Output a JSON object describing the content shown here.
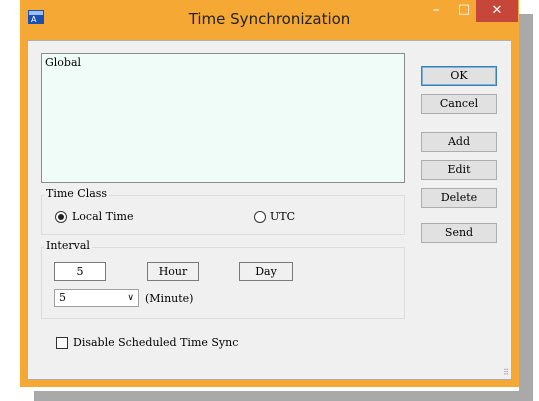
{
  "window": {
    "title": "Time Synchronization",
    "minimize": "–",
    "maximize": "□",
    "close": "✕"
  },
  "list": {
    "items": [
      "Global"
    ]
  },
  "buttons": {
    "ok": "OK",
    "cancel": "Cancel",
    "add": "Add",
    "edit": "Edit",
    "delete": "Delete",
    "send": "Send"
  },
  "time_class": {
    "label": "Time Class",
    "local": "Local Time",
    "utc": "UTC",
    "selected": "local"
  },
  "interval": {
    "label": "Interval",
    "value": "5",
    "hour": "Hour",
    "day": "Day",
    "minute_value": "5",
    "minute_label": "(Minute)"
  },
  "disable_sync": {
    "label": "Disable Scheduled Time Sync",
    "checked": false
  },
  "colors": {
    "titlebar": "#f6a834",
    "close": "#c7463a",
    "list_bg": "#effcf7"
  }
}
